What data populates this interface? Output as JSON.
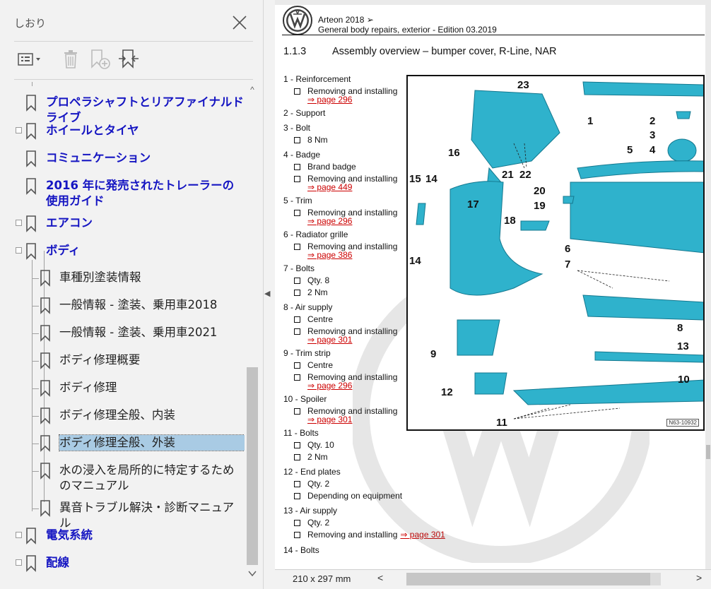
{
  "sidebar": {
    "title": "しおり",
    "tools": [
      "options-menu-icon",
      "delete-bookmark-icon",
      "new-bookmark-icon",
      "find-bookmark-icon"
    ],
    "items": [
      {
        "label": "プロペラシャフトとリアファイナルドライブ",
        "level": "top"
      },
      {
        "label": "ホイールとタイヤ",
        "level": "top"
      },
      {
        "label": "コミュニケーション",
        "level": "top"
      },
      {
        "label": "2016 年に発売されたトレーラーの使用ガイド",
        "level": "top"
      },
      {
        "label": "エアコン",
        "level": "top"
      },
      {
        "label": "ボディ",
        "level": "top"
      },
      {
        "label": "車種別塗装情報",
        "level": "sub"
      },
      {
        "label": "一般情報 - 塗装、乗用車2018",
        "level": "sub"
      },
      {
        "label": "一般情報 - 塗装、乗用車2021",
        "level": "sub"
      },
      {
        "label": "ボディ修理概要",
        "level": "sub"
      },
      {
        "label": "ボディ修理",
        "level": "sub"
      },
      {
        "label": "ボディ修理全般、内装",
        "level": "sub"
      },
      {
        "label": "ボディ修理全般、外装",
        "level": "sub",
        "selected": true
      },
      {
        "label": "水の浸入を局所的に特定するためのマニュアル",
        "level": "sub"
      },
      {
        "label": "異音トラブル解決・診断マニュアル",
        "level": "sub"
      },
      {
        "label": "電気系統",
        "level": "top"
      },
      {
        "label": "配線",
        "level": "top"
      }
    ],
    "scroll_up": "^",
    "scroll_down": "v"
  },
  "document": {
    "model": "Arteon 2018 ➢",
    "edition": "General body repairs, exterior - Edition 03.2019",
    "section_number": "1.1.3",
    "section_title": "Assembly overview – bumper cover, R-Line, NAR",
    "legend": [
      {
        "title": "1 - Reinforcement",
        "subs": [
          {
            "text": "Removing and installing",
            "link": "⇒ page 296"
          }
        ]
      },
      {
        "title": "2 - Support",
        "subs": []
      },
      {
        "title": "3 - Bolt",
        "subs": [
          {
            "text": "8 Nm"
          }
        ]
      },
      {
        "title": "4 - Badge",
        "subs": [
          {
            "text": "Brand badge"
          },
          {
            "text": "Removing and installing",
            "link": "⇒ page 449"
          }
        ]
      },
      {
        "title": "5 - Trim",
        "subs": [
          {
            "text": "Removing and installing",
            "link": "⇒ page 296"
          }
        ]
      },
      {
        "title": "6 - Radiator grille",
        "subs": [
          {
            "text": "Removing and installing",
            "link": "⇒ page 386"
          }
        ]
      },
      {
        "title": "7 - Bolts",
        "subs": [
          {
            "text": "Qty. 8"
          },
          {
            "text": "2 Nm"
          }
        ]
      },
      {
        "title": "8 - Air supply",
        "subs": [
          {
            "text": "Centre"
          },
          {
            "text": "Removing and installing",
            "link": "⇒ page 301"
          }
        ]
      },
      {
        "title": "9 - Trim strip",
        "subs": [
          {
            "text": "Centre"
          },
          {
            "text": "Removing and installing",
            "link": "⇒ page 296"
          }
        ]
      },
      {
        "title": "10 - Spoiler",
        "subs": [
          {
            "text": "Removing and installing",
            "link": "⇒ page 301"
          }
        ]
      },
      {
        "title": "11 - Bolts",
        "subs": [
          {
            "text": "Qty. 10"
          },
          {
            "text": "2 Nm"
          }
        ]
      },
      {
        "title": "12 - End plates",
        "subs": [
          {
            "text": "Qty. 2"
          },
          {
            "text": "Depending on equipment"
          }
        ]
      },
      {
        "title": "13 - Air supply",
        "subs": [
          {
            "text": "Qty. 2"
          },
          {
            "text": "Removing and installing",
            "link": "⇒ page 301"
          }
        ]
      },
      {
        "title": "14 - Bolts",
        "subs": []
      }
    ],
    "figure_labels": [
      "23",
      "1",
      "2",
      "3",
      "4",
      "5",
      "16",
      "21",
      "22",
      "15",
      "14",
      "20",
      "19",
      "17",
      "18",
      "6",
      "14",
      "7",
      "8",
      "9",
      "13",
      "10",
      "12",
      "11"
    ],
    "figure_id": "N63-10932"
  },
  "statusbar": {
    "page_size": "210 x 297 mm",
    "scroll_left": "<",
    "scroll_right": ">"
  },
  "colors": {
    "bookmark_top": "#1515c2",
    "selection": "#a9cbe4",
    "link": "#cc0000",
    "part_fill": "#2fb2cc"
  }
}
